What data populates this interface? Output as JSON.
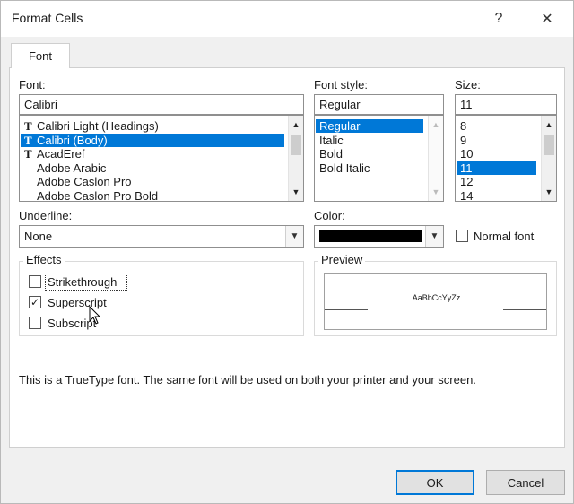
{
  "window": {
    "title": "Format Cells",
    "help_label": "?",
    "close_label": "✕"
  },
  "tabs": [
    {
      "label": "Font",
      "active": true
    }
  ],
  "font": {
    "label": "Font:",
    "value": "Calibri",
    "items": [
      {
        "label": "Calibri Light (Headings)",
        "icon": "truetype-icon",
        "selected": false
      },
      {
        "label": "Calibri (Body)",
        "icon": "truetype-icon",
        "selected": true
      },
      {
        "label": "AcadEref",
        "icon": "truetype-icon",
        "selected": false
      },
      {
        "label": "Adobe Arabic",
        "icon": "opentype-icon",
        "selected": false
      },
      {
        "label": "Adobe Caslon Pro",
        "icon": "opentype-icon",
        "selected": false
      },
      {
        "label": "Adobe Caslon Pro Bold",
        "icon": "opentype-icon",
        "selected": false
      }
    ]
  },
  "font_style": {
    "label": "Font style:",
    "value": "Regular",
    "items": [
      {
        "label": "Regular",
        "selected": true
      },
      {
        "label": "Italic",
        "selected": false
      },
      {
        "label": "Bold",
        "selected": false
      },
      {
        "label": "Bold Italic",
        "selected": false
      }
    ]
  },
  "size": {
    "label": "Size:",
    "value": "11",
    "items": [
      {
        "label": "8",
        "selected": false
      },
      {
        "label": "9",
        "selected": false
      },
      {
        "label": "10",
        "selected": false
      },
      {
        "label": "11",
        "selected": true
      },
      {
        "label": "12",
        "selected": false
      },
      {
        "label": "14",
        "selected": false
      }
    ]
  },
  "underline": {
    "label": "Underline:",
    "value": "None"
  },
  "color": {
    "label": "Color:",
    "swatch": "#000000"
  },
  "normal_font": {
    "label": "Normal font",
    "checked": false
  },
  "effects": {
    "title": "Effects",
    "items": [
      {
        "label": "Strikethrough",
        "checked": false
      },
      {
        "label": "Superscript",
        "checked": true
      },
      {
        "label": "Subscript",
        "checked": false
      }
    ]
  },
  "preview": {
    "title": "Preview",
    "sample": "AaBbCcYyZz"
  },
  "info_text": "This is a TrueType font.  The same font will be used on both your printer and your screen.",
  "buttons": {
    "ok": "OK",
    "cancel": "Cancel"
  },
  "colors": {
    "selection": "#0078d7",
    "default_button_border": "#0078d7"
  }
}
